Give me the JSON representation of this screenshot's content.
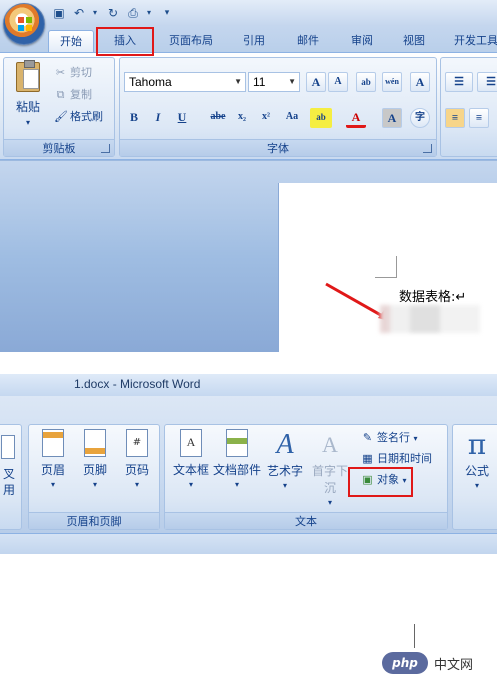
{
  "top": {
    "tabs": [
      "开始",
      "插入",
      "页面布局",
      "引用",
      "邮件",
      "审阅",
      "视图",
      "开发工具"
    ],
    "clipboard": {
      "paste_label": "粘贴",
      "cut_label": "剪切",
      "copy_label": "复制",
      "format_painter_label": "格式刷",
      "group_label": "剪贴板"
    },
    "font": {
      "font_name": "Tahoma",
      "font_size": "11",
      "grow_label": "A",
      "shrink_label": "A",
      "clear_label": "ab",
      "wen_label": "wén",
      "border_label": "A",
      "bold_label": "B",
      "italic_label": "I",
      "underline_label": "U",
      "strike_label": "abe",
      "subscript_label": "x₂",
      "superscript_label": "x²",
      "case_label": "Aa",
      "highlight_label": "ab",
      "color_label": "A",
      "shade_label": "A",
      "enclose_label": "字",
      "group_label": "字体"
    },
    "document_text": "数据表格:↵"
  },
  "bottom": {
    "window_title": "1.docx - Microsoft Word",
    "edge_label_1": "叉",
    "edge_label_2": "用",
    "header_footer": {
      "header_label": "页眉",
      "footer_label": "页脚",
      "page_number_label": "页码",
      "group_label": "页眉和页脚"
    },
    "text": {
      "textbox_label": "文本框",
      "quickparts_label": "文档部件",
      "wordart_label": "艺术字",
      "dropcap_label": "首字下沉",
      "signature_label": "签名行",
      "datetime_label": "日期和时间",
      "object_label": "对象",
      "group_label": "文本"
    },
    "symbols": {
      "equation_symbol": "π",
      "equation_label": "公式"
    },
    "watermark": {
      "logo_text": "php",
      "site_text": "中文网"
    }
  },
  "colors": {
    "highlight_box": "#e01818",
    "ribbon_text": "#15428b",
    "arrow": "#e01818"
  }
}
